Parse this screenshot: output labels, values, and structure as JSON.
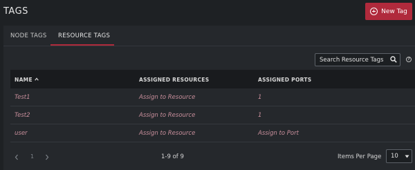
{
  "header": {
    "title": "TAGS",
    "new_button_label": "New Tag",
    "new_button_icon": "plus-circle-icon"
  },
  "tabs": [
    {
      "label": "NODE TAGS",
      "active": false
    },
    {
      "label": "RESOURCE TAGS",
      "active": true
    }
  ],
  "search": {
    "placeholder": "Search Resource Tags",
    "value": "",
    "icon": "search-icon"
  },
  "help_icon": "help-icon",
  "table": {
    "columns": [
      {
        "label": "NAME",
        "sort": "ascending"
      },
      {
        "label": "ASSIGNED RESOURCES"
      },
      {
        "label": "ASSIGNED PORTS"
      }
    ],
    "rows": [
      {
        "name": "Test1",
        "resources": "Assign to Resource",
        "ports": "1"
      },
      {
        "name": "Test2",
        "resources": "Assign to Resource",
        "ports": "1"
      },
      {
        "name": "user",
        "resources": "Assign to Resource",
        "ports": "Assign to Port"
      }
    ]
  },
  "pagination": {
    "current_page": "1",
    "range_text": "1-9 of 9",
    "items_per_page_label": "Items Per Page",
    "items_per_page_value": "10"
  },
  "colors": {
    "background": "#1e2124",
    "card": "#25282c",
    "accent": "#b02a3c",
    "link": "#c98f9c"
  }
}
